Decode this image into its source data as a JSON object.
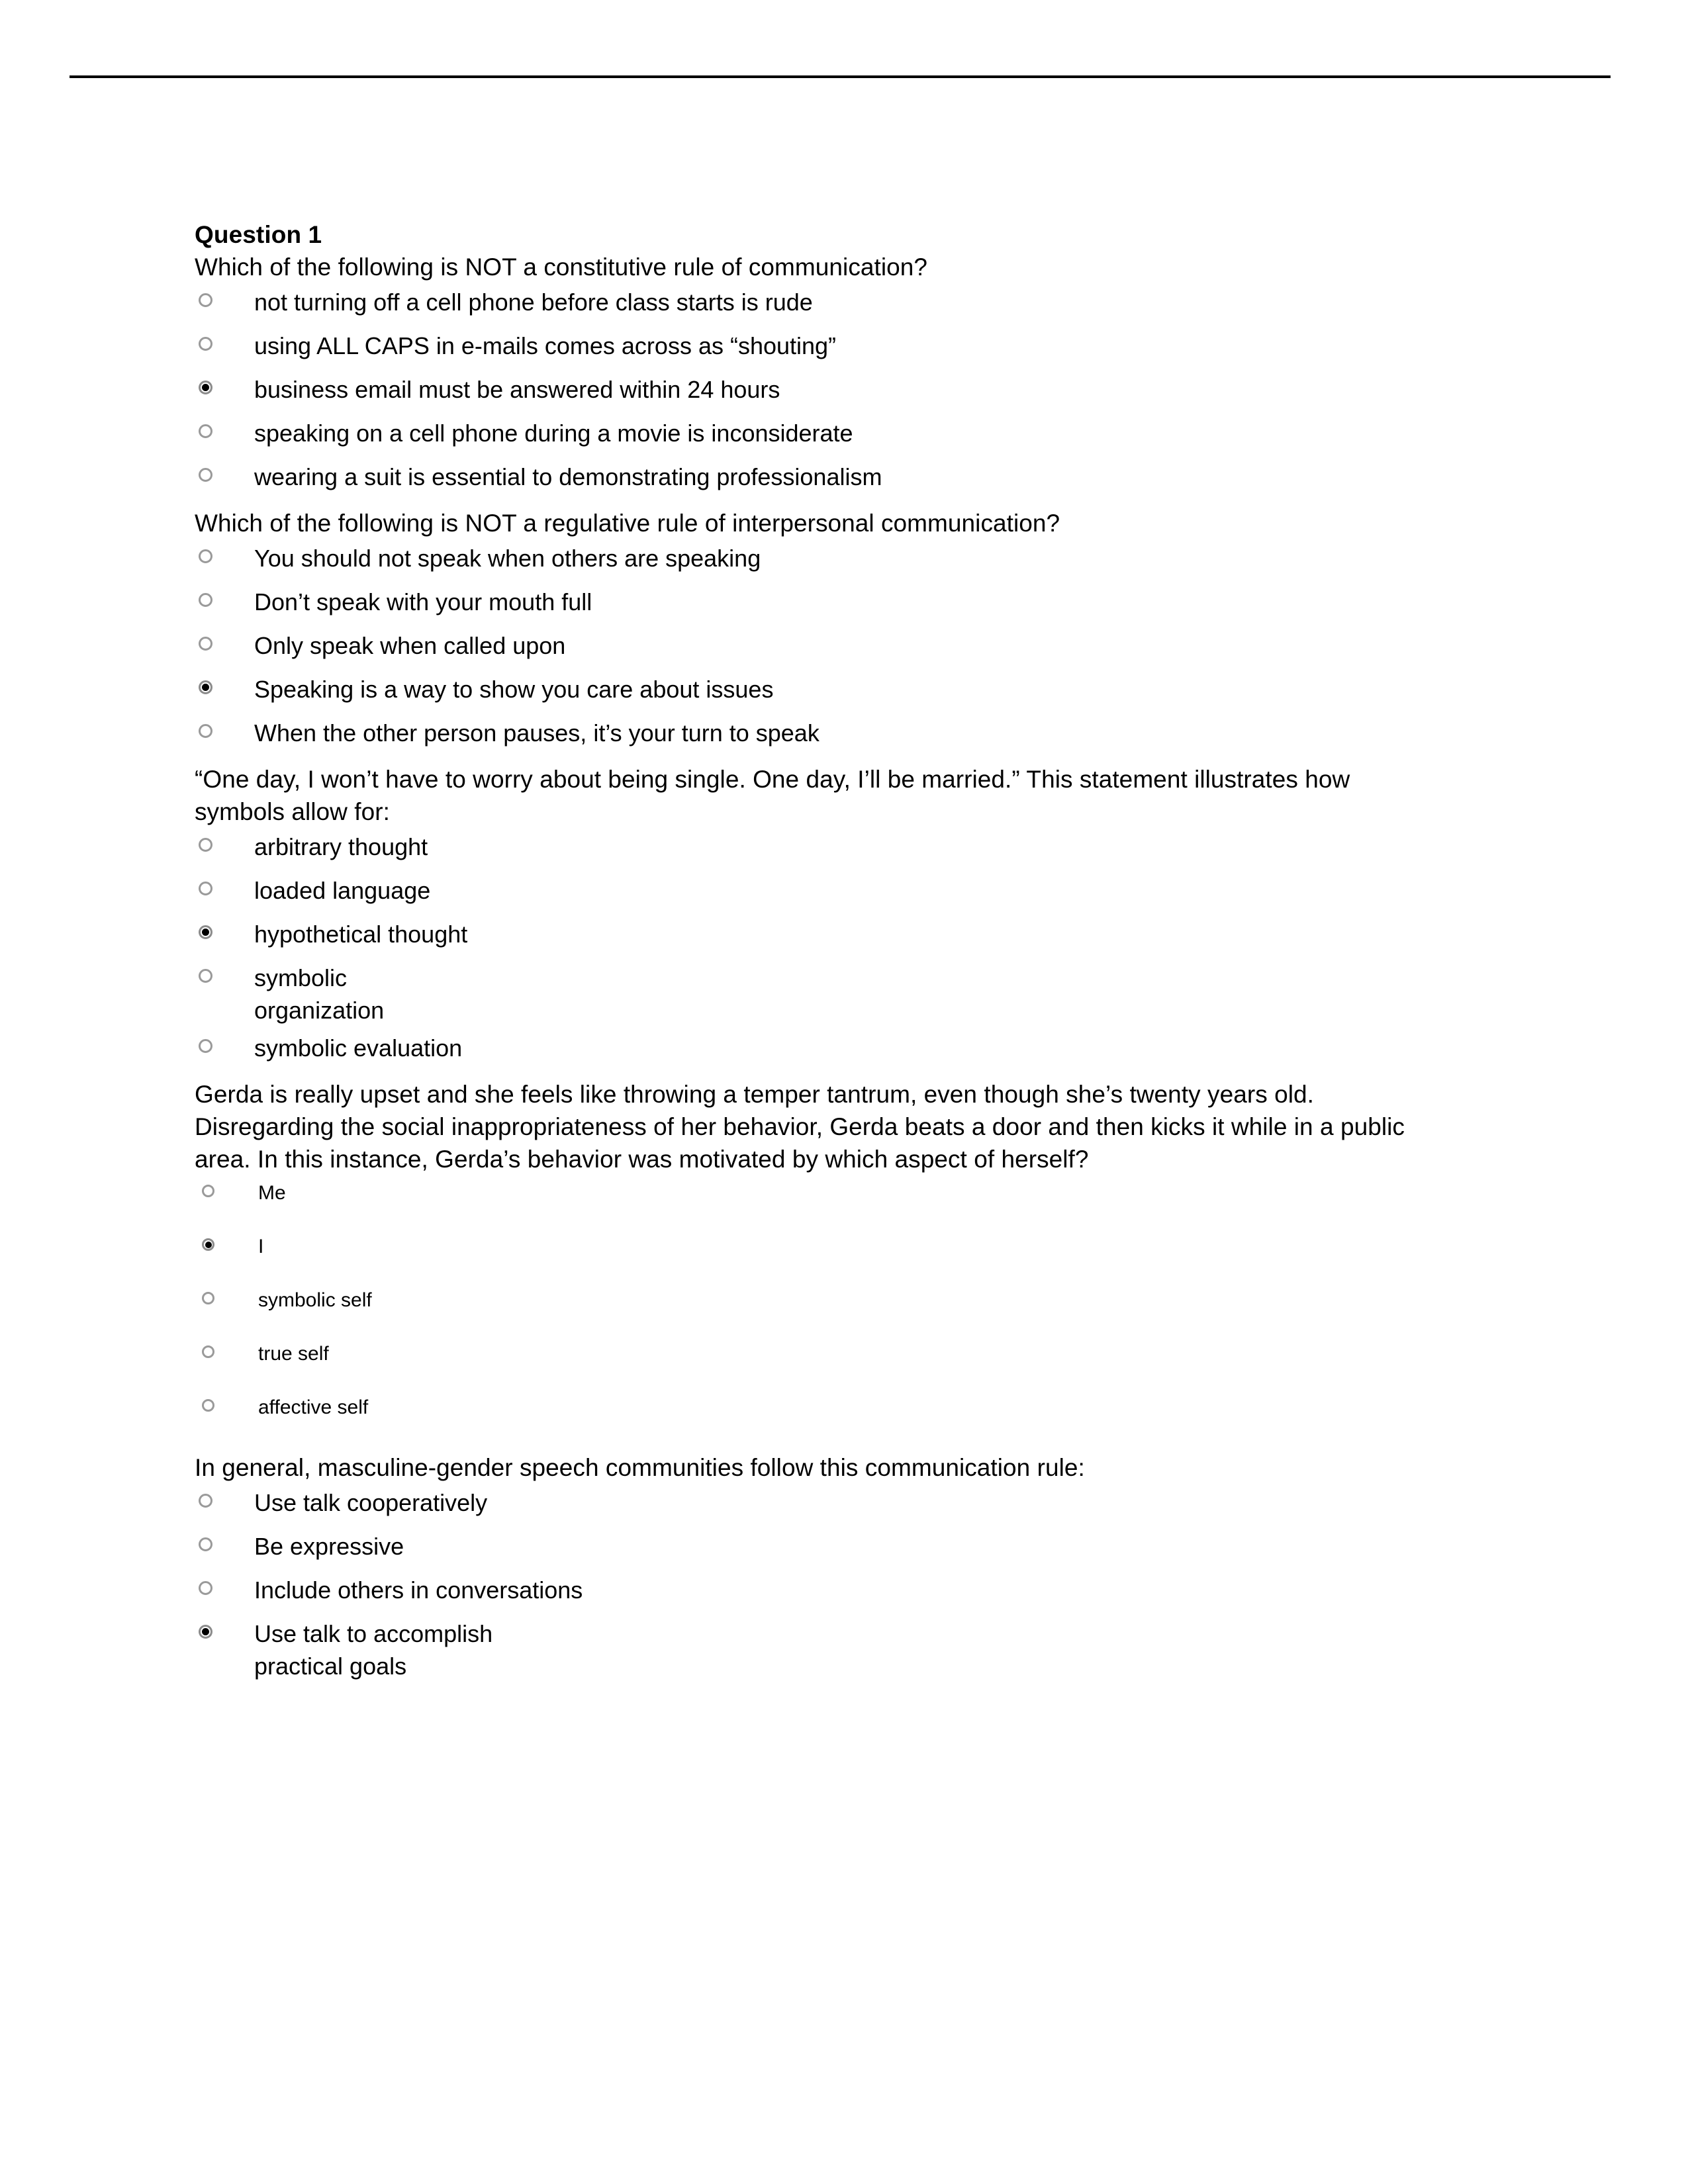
{
  "document": {
    "header_rule": true,
    "question_number_label": "Question 1"
  },
  "questions": [
    {
      "stem": "Which of the following is NOT a constitutive rule of communication?",
      "options": [
        {
          "label": "not turning off a cell phone before class starts is rude",
          "selected": false
        },
        {
          "label": "using ALL CAPS in e-mails comes across as “shouting”",
          "selected": false
        },
        {
          "label": "business email must be answered within 24 hours",
          "selected": true
        },
        {
          "label": "speaking on a cell phone during a movie is inconsiderate",
          "selected": false
        },
        {
          "label": "wearing a suit is essential to demonstrating professionalism",
          "selected": false
        }
      ]
    },
    {
      "stem": "Which of the following is NOT a regulative rule of interpersonal communication?",
      "options": [
        {
          "label": "You should not speak when others are speaking",
          "selected": false
        },
        {
          "label": "Don’t speak with your mouth full",
          "selected": false
        },
        {
          "label": "Only speak when called upon",
          "selected": false
        },
        {
          "label": "Speaking is a way to show you care about issues",
          "selected": true
        },
        {
          "label": "When the other person pauses, it’s your turn to speak",
          "selected": false
        }
      ]
    },
    {
      "stem": "“One day, I won’t have to worry about being single. One day, I’ll be married.” This statement illustrates how symbols allow for:",
      "options": [
        {
          "label": "arbitrary thought",
          "selected": false
        },
        {
          "label": "loaded language",
          "selected": false
        },
        {
          "label": "hypothetical thought",
          "selected": true
        },
        {
          "label": "symbolic organization",
          "selected": false
        },
        {
          "label": "symbolic evaluation",
          "selected": false
        }
      ]
    },
    {
      "stem": "Gerda is really upset and she feels like throwing a temper tantrum, even though she’s twenty years old. Disregarding the social inappropriateness of her behavior, Gerda beats a door and then kicks it while in a public area. In this instance, Gerda’s behavior was motivated by which aspect of herself?",
      "compact": true,
      "options": [
        {
          "label": "Me",
          "selected": false
        },
        {
          "label": "I",
          "selected": true
        },
        {
          "label": "symbolic self",
          "selected": false
        },
        {
          "label": "true self",
          "selected": false
        },
        {
          "label": "affective self",
          "selected": false
        }
      ]
    },
    {
      "stem": "In general, masculine-gender speech communities follow this communication rule:",
      "options": [
        {
          "label": "Use talk cooperatively",
          "selected": false
        },
        {
          "label": "Be expressive",
          "selected": false
        },
        {
          "label": "Include others in conversations",
          "selected": false
        },
        {
          "label": "Use talk to accomplish practical goals",
          "selected": true
        }
      ]
    }
  ]
}
